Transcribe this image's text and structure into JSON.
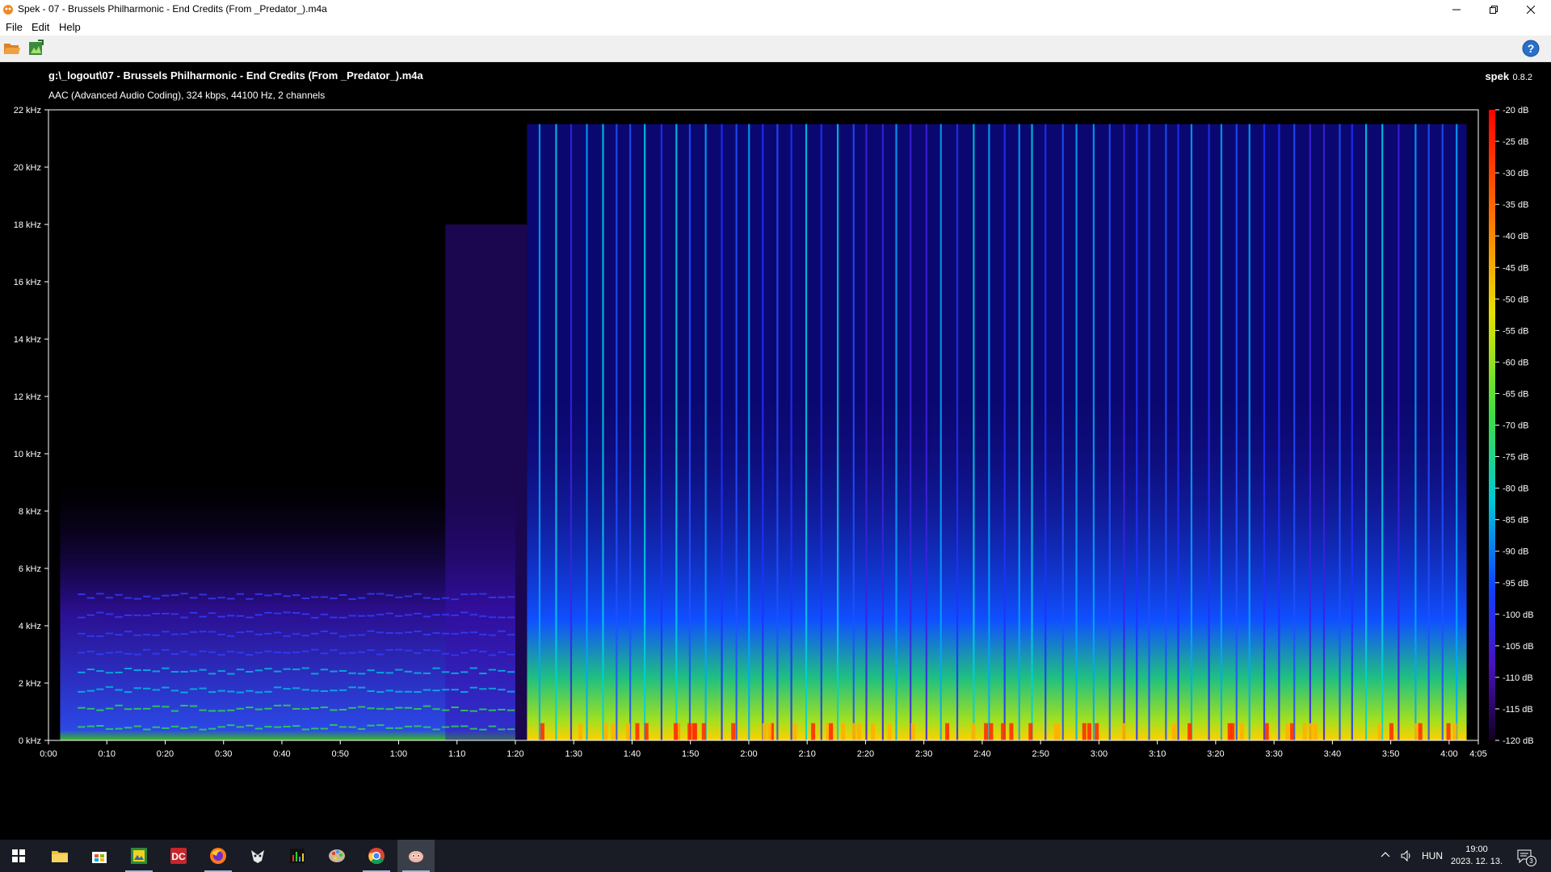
{
  "window": {
    "title": "Spek - 07 - Brussels Philharmonic - End Credits (From _Predator_).m4a",
    "icons": {
      "app": "spek-icon",
      "minimize": "minimize-icon",
      "maximize": "restore-icon",
      "close": "close-icon"
    }
  },
  "menu": {
    "items": [
      "File",
      "Edit",
      "Help"
    ]
  },
  "toolbar": {
    "open_icon": "folder-open-icon",
    "save_icon": "save-image-icon",
    "help_icon": "help-icon"
  },
  "spectrogram": {
    "file_path": "g:\\_logout\\07 - Brussels Philharmonic - End Credits (From _Predator_).m4a",
    "codec_info": "AAC (Advanced Audio Coding), 324 kbps, 44100 Hz, 2 channels",
    "brand": "spek",
    "version": "0.8.2",
    "freq_ticks": [
      "22 kHz",
      "20 kHz",
      "18 kHz",
      "16 kHz",
      "14 kHz",
      "12 kHz",
      "10 kHz",
      "8 kHz",
      "6 kHz",
      "4 kHz",
      "2 kHz",
      "0 kHz"
    ],
    "time_ticks": [
      "0:00",
      "0:10",
      "0:20",
      "0:30",
      "0:40",
      "0:50",
      "1:00",
      "1:10",
      "1:20",
      "1:30",
      "1:40",
      "1:50",
      "2:00",
      "2:10",
      "2:20",
      "2:30",
      "2:40",
      "2:50",
      "3:00",
      "3:10",
      "3:20",
      "3:30",
      "3:40",
      "3:50",
      "4:00",
      "4:05"
    ],
    "db_ticks": [
      "-20 dB",
      "-25 dB",
      "-30 dB",
      "-35 dB",
      "-40 dB",
      "-45 dB",
      "-50 dB",
      "-55 dB",
      "-60 dB",
      "-65 dB",
      "-70 dB",
      "-75 dB",
      "-80 dB",
      "-85 dB",
      "-90 dB",
      "-95 dB",
      "-100 dB",
      "-105 dB",
      "-110 dB",
      "-115 dB",
      "-120 dB"
    ],
    "duration_seconds": 245,
    "max_freq_khz": 22,
    "palette": [
      "#000000",
      "#1a0030",
      "#3a0a8f",
      "#2030ff",
      "#00a8ff",
      "#00e0b0",
      "#30e030",
      "#c8e820",
      "#ffc000",
      "#ff4000",
      "#ff0000"
    ]
  },
  "taskbar": {
    "apps": [
      "windows-start-icon",
      "file-explorer-icon",
      "store-icon",
      "image-viewer-icon",
      "directory-opus-icon",
      "firefox-icon",
      "foobar-icon",
      "spectrum-app-icon",
      "paint-palette-icon",
      "chrome-icon",
      "spek-taskbar-icon"
    ],
    "language": "HUN",
    "time": "19:00",
    "date": "2023. 12. 13.",
    "notification_count": "3"
  }
}
